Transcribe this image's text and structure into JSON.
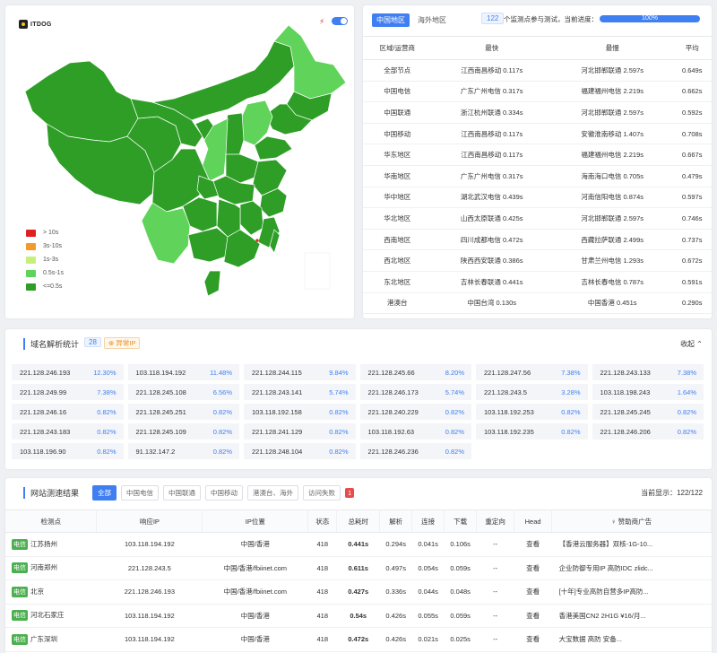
{
  "map": {
    "logo_text": "ITDOG",
    "legend": [
      {
        "label": "> 10s",
        "color": "#e02020"
      },
      {
        "label": "3s-10s",
        "color": "#f39a2e"
      },
      {
        "label": "1s-3s",
        "color": "#c7ef7b"
      },
      {
        "label": "0.5s-1s",
        "color": "#5fd35a"
      },
      {
        "label": "<=0.5s",
        "color": "#2e9e27"
      }
    ]
  },
  "stats": {
    "tabs": [
      "中国地区",
      "海外地区"
    ],
    "node_count": "122",
    "progress_label": "个监测点参与测试，当前进度：",
    "progress_text": "100%",
    "progress_value": 100,
    "columns": [
      "区域/运营商",
      "最快",
      "最慢",
      "平均"
    ],
    "rows": [
      [
        "全部节点",
        "江西南昌移动 0.117s",
        "河北邯郸联通 2.597s",
        "0.649s"
      ],
      [
        "中国电信",
        "广东广州电信 0.317s",
        "福建福州电信 2.219s",
        "0.662s"
      ],
      [
        "中国联通",
        "浙江杭州联通 0.334s",
        "河北邯郸联通 2.597s",
        "0.592s"
      ],
      [
        "中国移动",
        "江西南昌移动 0.117s",
        "安徽淮南移动 1.407s",
        "0.708s"
      ],
      [
        "华东地区",
        "江西南昌移动 0.117s",
        "福建福州电信 2.219s",
        "0.667s"
      ],
      [
        "华南地区",
        "广东广州电信 0.317s",
        "海南海口电信 0.705s",
        "0.479s"
      ],
      [
        "华中地区",
        "湖北武汉电信 0.439s",
        "河南信阳电信 0.874s",
        "0.597s"
      ],
      [
        "华北地区",
        "山西太原联通 0.425s",
        "河北邯郸联通 2.597s",
        "0.746s"
      ],
      [
        "西南地区",
        "四川成都电信 0.472s",
        "西藏拉萨联通 2.499s",
        "0.737s"
      ],
      [
        "西北地区",
        "陕西西安联通 0.386s",
        "甘肃兰州电信 1.293s",
        "0.672s"
      ],
      [
        "东北地区",
        "吉林长春联通 0.441s",
        "吉林长春电信 0.787s",
        "0.591s"
      ],
      [
        "港澳台",
        "中国台湾 0.130s",
        "中国香港 0.451s",
        "0.290s"
      ]
    ]
  },
  "dns": {
    "title": "域名解析统计",
    "count": "28",
    "abnormal": "异常IP",
    "collapse": "收起",
    "items": [
      [
        "221.128.246.193",
        "12.30%"
      ],
      [
        "103.118.194.192",
        "11.48%"
      ],
      [
        "221.128.244.115",
        "9.84%"
      ],
      [
        "221.128.245.66",
        "8.20%"
      ],
      [
        "221.128.247.56",
        "7.38%"
      ],
      [
        "221.128.243.133",
        "7.38%"
      ],
      [
        "221.128.249.99",
        "7.38%"
      ],
      [
        "221.128.245.108",
        "6.56%"
      ],
      [
        "221.128.243.141",
        "5.74%"
      ],
      [
        "221.128.246.173",
        "5.74%"
      ],
      [
        "221.128.243.5",
        "3.28%"
      ],
      [
        "103.118.198.243",
        "1.64%"
      ],
      [
        "221.128.246.16",
        "0.82%"
      ],
      [
        "221.128.245.251",
        "0.82%"
      ],
      [
        "103.118.192.158",
        "0.82%"
      ],
      [
        "221.128.240.229",
        "0.82%"
      ],
      [
        "103.118.192.253",
        "0.82%"
      ],
      [
        "221.128.245.245",
        "0.82%"
      ],
      [
        "221.128.243.183",
        "0.82%"
      ],
      [
        "221.128.245.109",
        "0.82%"
      ],
      [
        "221.128.241.129",
        "0.82%"
      ],
      [
        "103.118.192.63",
        "0.82%"
      ],
      [
        "103.118.192.235",
        "0.82%"
      ],
      [
        "221.128.246.206",
        "0.82%"
      ],
      [
        "103.118.196.90",
        "0.82%"
      ],
      [
        "91.132.147.2",
        "0.82%"
      ],
      [
        "221.128.248.104",
        "0.82%"
      ],
      [
        "221.128.246.236",
        "0.82%"
      ]
    ]
  },
  "tests": {
    "title": "网站测速结果",
    "filters": [
      "全部",
      "中国电信",
      "中国联通",
      "中国移动",
      "港澳台、海外",
      "访问失败"
    ],
    "fail_count": "1",
    "current": "当前显示：122/122",
    "columns": [
      "检测点",
      "响应IP",
      "IP位置",
      "状态",
      "总耗时",
      "解析",
      "连接",
      "下载",
      "重定向",
      "Head",
      "赞助商广告"
    ],
    "rows": [
      {
        "isp": "电信",
        "loc": "江苏扬州",
        "ip": "103.118.194.192",
        "geo": "中国/香港",
        "status": "418",
        "total": "0.441s",
        "dns": "0.294s",
        "conn": "0.041s",
        "down": "0.106s",
        "redir": "--",
        "head": "查看",
        "ad": "【香港云服务器】双核-1G-10..."
      },
      {
        "isp": "电信",
        "loc": "河南郑州",
        "ip": "221.128.243.5",
        "geo": "中国/香港/fbiinet.com",
        "status": "418",
        "total": "0.611s",
        "dns": "0.497s",
        "conn": "0.054s",
        "down": "0.059s",
        "redir": "--",
        "head": "查看",
        "ad": "企业防御专用IP 高防IDC zlidc..."
      },
      {
        "isp": "电信",
        "loc": "北京",
        "ip": "221.128.246.193",
        "geo": "中国/香港/fbiinet.com",
        "status": "418",
        "total": "0.427s",
        "dns": "0.336s",
        "conn": "0.044s",
        "down": "0.048s",
        "redir": "--",
        "head": "查看",
        "ad": "[十年]专业高防自营多IP高防..."
      },
      {
        "isp": "电信",
        "loc": "河北石家庄",
        "ip": "103.118.194.192",
        "geo": "中国/香港",
        "status": "418",
        "total": "0.54s",
        "dns": "0.426s",
        "conn": "0.055s",
        "down": "0.059s",
        "redir": "--",
        "head": "查看",
        "ad": "香港美国CN2 2H1G ¥16/月..."
      },
      {
        "isp": "电信",
        "loc": "广东深圳",
        "ip": "103.118.194.192",
        "geo": "中国/香港",
        "status": "418",
        "total": "0.472s",
        "dns": "0.426s",
        "conn": "0.021s",
        "down": "0.025s",
        "redir": "--",
        "head": "查看",
        "ad": "大宝数据 高防 安备..."
      }
    ]
  }
}
